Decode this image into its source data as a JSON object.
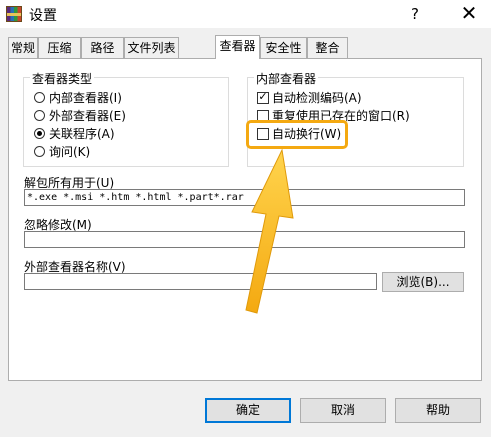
{
  "window": {
    "title": "设置",
    "help_glyph": "?",
    "close_glyph": "✕"
  },
  "tabs": [
    {
      "label": "常规"
    },
    {
      "label": "压缩"
    },
    {
      "label": "路径"
    },
    {
      "label": "文件列表"
    },
    {
      "label": "查看器",
      "active": true
    },
    {
      "label": "安全性"
    },
    {
      "label": "整合"
    }
  ],
  "viewer_type": {
    "title": "查看器类型",
    "options": [
      {
        "label": "内部查看器(I)",
        "selected": false
      },
      {
        "label": "外部查看器(E)",
        "selected": false
      },
      {
        "label": "关联程序(A)",
        "selected": true
      },
      {
        "label": "询问(K)",
        "selected": false
      }
    ]
  },
  "internal_viewer": {
    "title": "内部查看器",
    "options": [
      {
        "label": "自动检测编码(A)",
        "checked": true,
        "check_glyph": "✓"
      },
      {
        "label": "重复使用已存在的窗口(R)",
        "checked": false,
        "check_glyph": ""
      },
      {
        "label": "自动换行(W)",
        "checked": false,
        "check_glyph": ""
      }
    ]
  },
  "unpack_all": {
    "label": "解包所有用于(U)",
    "value": "*.exe *.msi *.htm *.html *.part*.rar"
  },
  "ignore_modified": {
    "label": "忽略修改(M)",
    "value": ""
  },
  "external_viewer": {
    "label": "外部查看器名称(V)",
    "value": "",
    "browse_label": "浏览(B)..."
  },
  "footer": {
    "ok_label": "确定",
    "cancel_label": "取消",
    "help_label": "帮助"
  },
  "annotation_color": "#f4a911"
}
